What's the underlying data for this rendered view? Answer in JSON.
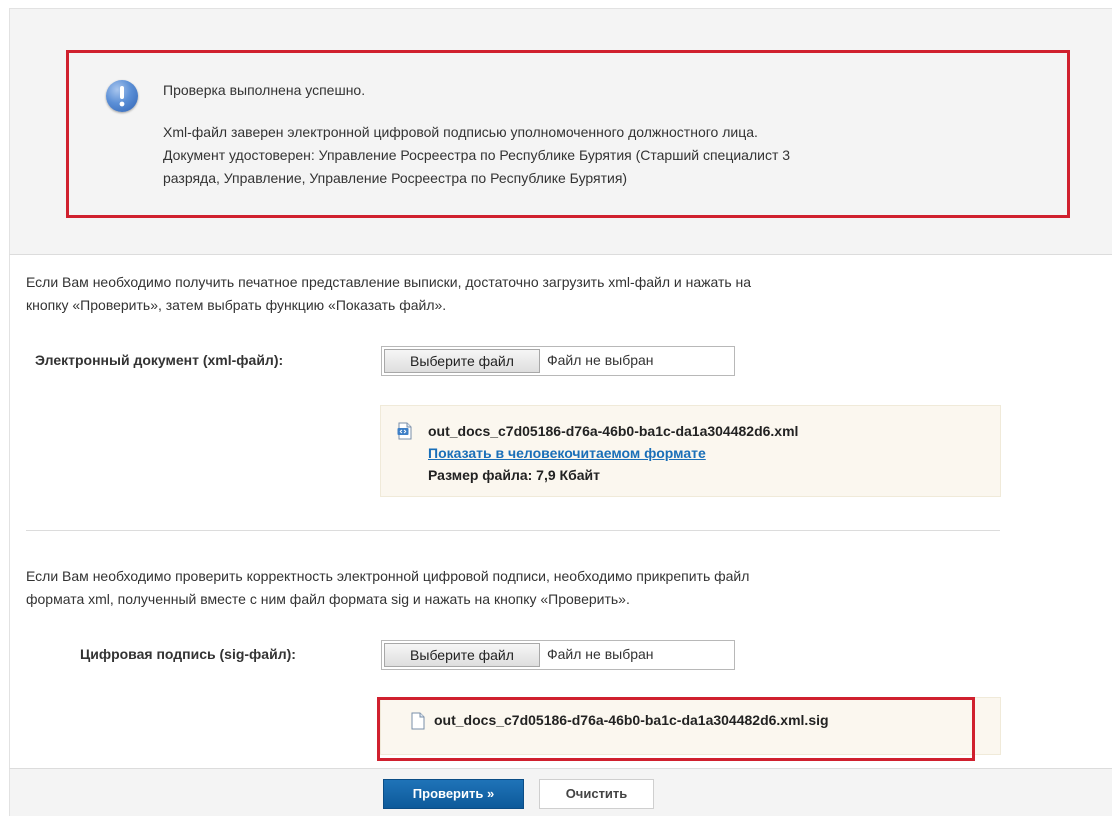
{
  "message": {
    "title": "Проверка выполнена успешно.",
    "line1": "Xml-файл заверен электронной цифровой подписью уполномоченного должностного лица.",
    "line2": "Документ удостоверен: Управление Росреестра по Республике Бурятия (Старший специалист 3",
    "line3": "разряда, Управление, Управление Росреестра по Республике Бурятия)",
    "icon": "info-exclamation-icon"
  },
  "xml_section": {
    "intro_line1": "Если Вам необходимо получить печатное представление выписки, достаточно загрузить xml-файл и нажать на",
    "intro_line2": "кнопку «Проверить», затем выбрать функцию «Показать файл».",
    "field_label": "Электронный документ (xml-файл):",
    "choose_button": "Выберите файл",
    "file_status": "Файл не выбран",
    "uploaded_file": {
      "name": "out_docs_c7d05186-d76a-46b0-ba1c-da1a304482d6.xml",
      "link": "Показать в человекочитаемом формате",
      "size": "Размер файла: 7,9 Кбайт",
      "icon": "xml-file-icon"
    }
  },
  "sig_section": {
    "intro_line1": "Если Вам необходимо проверить корректность электронной цифровой подписи, необходимо прикрепить файл",
    "intro_line2": "формата xml, полученный вместе с ним файл формата sig и нажать на кнопку «Проверить».",
    "field_label": "Цифровая подпись (sig-файл):",
    "choose_button": "Выберите файл",
    "file_status": "Файл не выбран",
    "uploaded_file": {
      "name": "out_docs_c7d05186-d76a-46b0-ba1c-da1a304482d6.xml.sig",
      "icon": "document-file-icon"
    }
  },
  "actions": {
    "check": "Проверить »",
    "clear": "Очистить"
  },
  "colors": {
    "highlight_border": "#d0202e",
    "primary_button": "#1566a8",
    "link": "#1a6fb8"
  }
}
